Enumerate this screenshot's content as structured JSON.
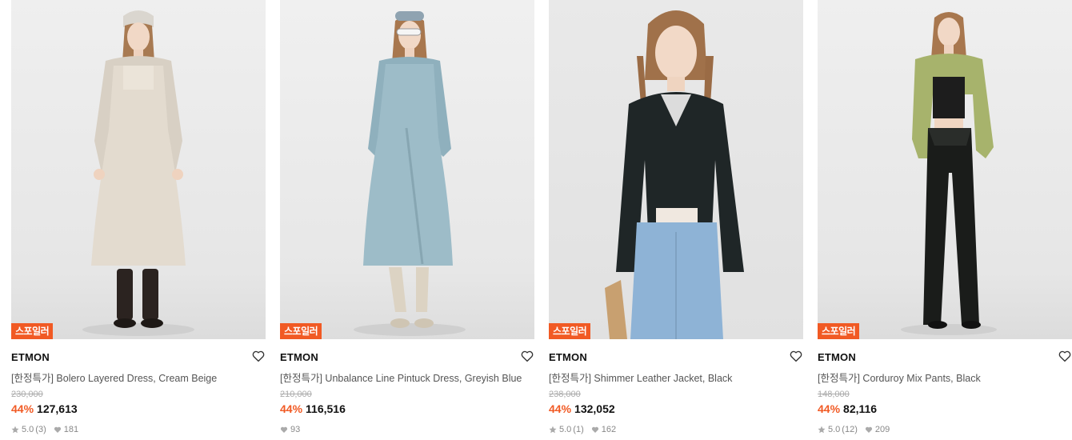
{
  "colors": {
    "accent": "#f15a24",
    "badge_bg": "#f15a24"
  },
  "products": [
    {
      "badge": "스포일러",
      "brand": "ETMON",
      "title": "[한정특가] Bolero Layered Dress, Cream Beige",
      "original_price": "230,000",
      "discount": "44%",
      "price": "127,613",
      "rating": "5.0",
      "review_count": "(3)",
      "likes": "181",
      "image_icon": "model-photo-cream-dress"
    },
    {
      "badge": "스포일러",
      "brand": "ETMON",
      "title": "[한정특가] Unbalance Line Pintuck Dress, Greyish Blue",
      "original_price": "210,000",
      "discount": "44%",
      "price": "116,516",
      "rating": "",
      "review_count": "",
      "likes": "93",
      "image_icon": "model-photo-blue-dress"
    },
    {
      "badge": "스포일러",
      "brand": "ETMON",
      "title": "[한정특가] Shimmer Leather Jacket, Black",
      "original_price": "238,000",
      "discount": "44%",
      "price": "132,052",
      "rating": "5.0",
      "review_count": "(1)",
      "likes": "162",
      "image_icon": "model-photo-black-jacket"
    },
    {
      "badge": "스포일러",
      "brand": "ETMON",
      "title": "[한정특가] Corduroy Mix Pants, Black",
      "original_price": "148,000",
      "discount": "44%",
      "price": "82,116",
      "rating": "5.0",
      "review_count": "(12)",
      "likes": "209",
      "image_icon": "model-photo-black-pants"
    }
  ]
}
